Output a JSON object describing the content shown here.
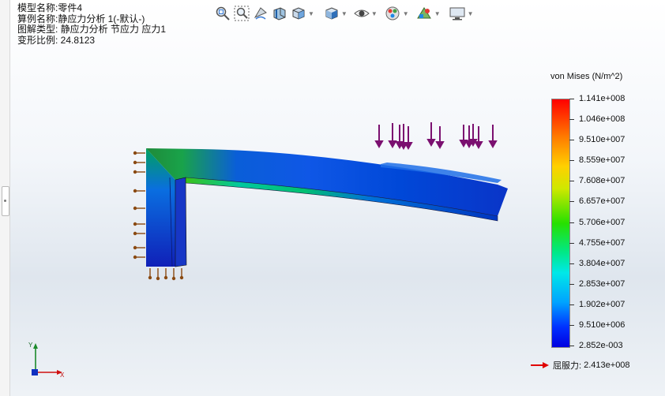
{
  "info": {
    "model_line": "模型名称:零件4",
    "study_line": "算例名称:静应力分析 1(-默认-)",
    "plot_line": "图解类型: 静应力分析 节应力 应力1",
    "deform_line": "变形比例: 24.8123"
  },
  "toolbar": {
    "icons": [
      "zoom-to-fit-icon",
      "zoom-to-area-icon",
      "previous-view-icon",
      "section-view-icon",
      "view-orientation-icon",
      "display-style-icon",
      "hide-show-items-icon",
      "edit-appearance-icon",
      "apply-scene-icon",
      "view-settings-icon"
    ]
  },
  "legend": {
    "title": "von Mises (N/m^2)",
    "labels": [
      "1.141e+008",
      "1.046e+008",
      "9.510e+007",
      "8.559e+007",
      "7.608e+007",
      "6.657e+007",
      "5.706e+007",
      "4.755e+007",
      "3.804e+007",
      "2.853e+007",
      "1.902e+007",
      "9.510e+006",
      "2.852e-003"
    ],
    "colors": [
      "#ff0000",
      "#ff7a00",
      "#ffd000",
      "#cfe800",
      "#27e000",
      "#00e88a",
      "#00e8e8",
      "#00a2ff",
      "#0030ff",
      "#0000e0"
    ]
  },
  "yield": {
    "label": "屈服力:",
    "value": "2.413e+008",
    "arrow_color": "#e00000"
  },
  "triad": {
    "y_label": "Y",
    "x_label": "X"
  },
  "colors": {
    "load_arrow": "#7b1070",
    "fixture": "#8a4a12"
  }
}
